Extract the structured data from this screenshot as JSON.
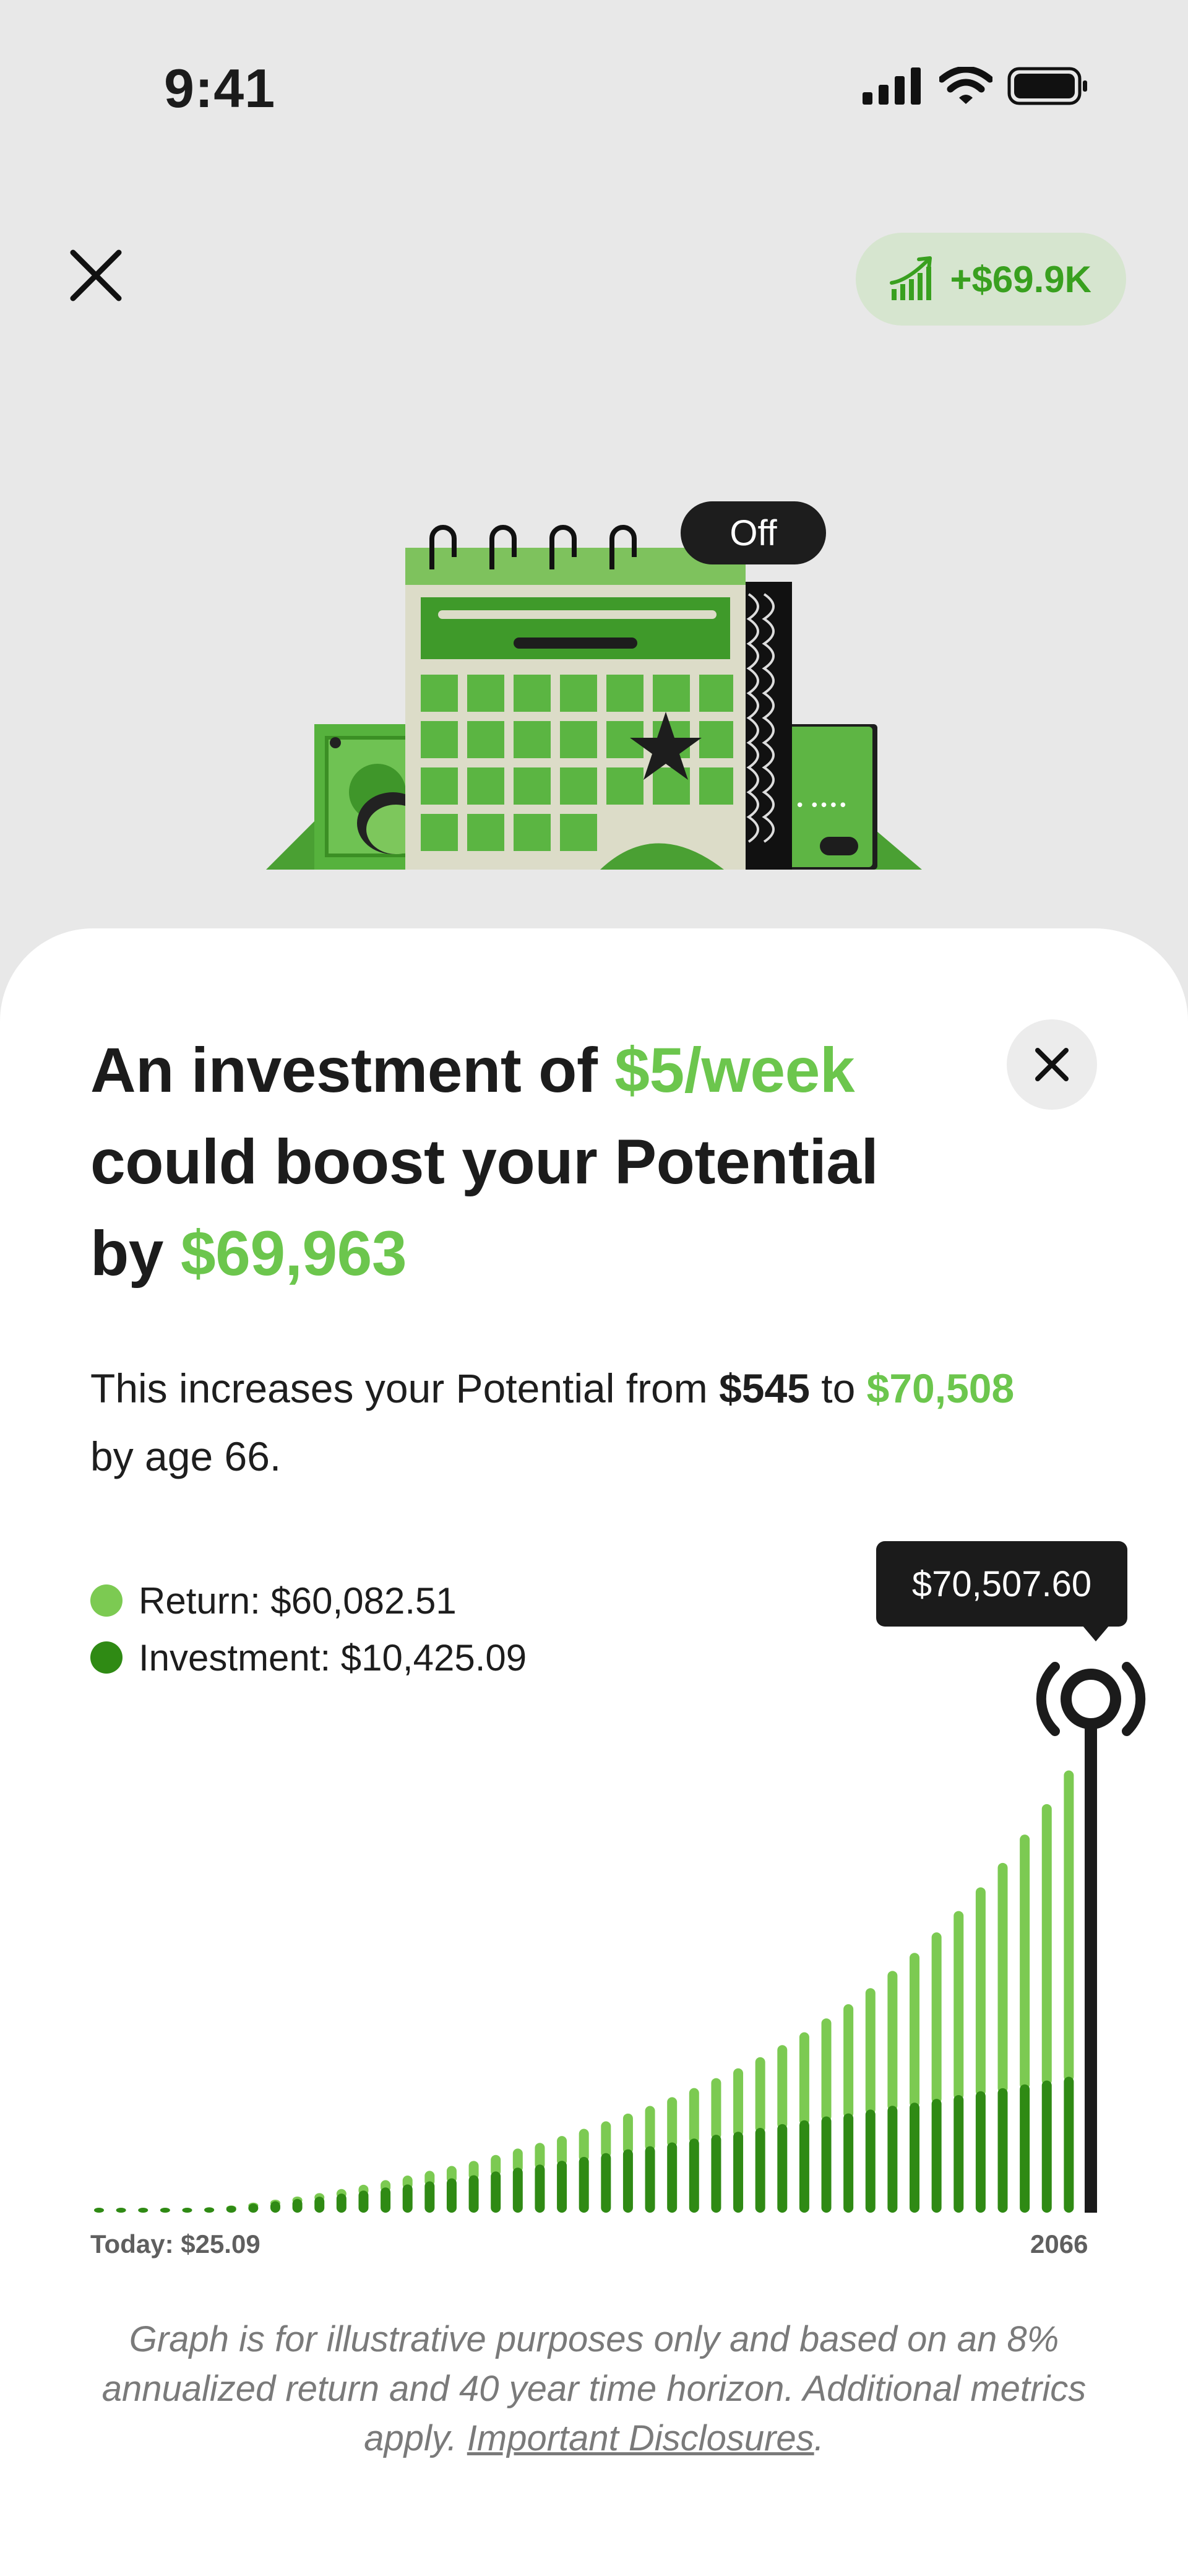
{
  "status_bar": {
    "time": "9:41"
  },
  "header": {
    "growth_pill": "+$69.9K"
  },
  "illustration": {
    "badge": "Off"
  },
  "sheet": {
    "headline_line1_prefix": "An investment of ",
    "headline_amount": "$5/week",
    "headline_line2": "could boost your Potential",
    "headline_line3_prefix": "by ",
    "headline_boost": "$69,963",
    "subtext_prefix": "This increases your Potential from ",
    "subtext_from": "$545",
    "subtext_mid": " to ",
    "subtext_to": "$70,508",
    "subtext_suffix": "by age 66.",
    "legend": {
      "return_label": "Return: $60,082.51",
      "investment_label": "Investment: $10,425.09"
    },
    "tooltip": "$70,507.60",
    "x_start_label": "Today: $25.09",
    "x_end_label": "2066",
    "footnote_text": "Graph is for illustrative purposes only and based on an 8% annualized return and 40 year time horizon. Additional metrics apply. ",
    "footnote_link": "Important Disclosures",
    "footnote_end": "."
  },
  "colors": {
    "return": "#7cca52",
    "investment": "#2f8a14",
    "accent": "#6cc64d",
    "dark": "#1b1b1b"
  },
  "chart_data": {
    "type": "bar",
    "stacked": true,
    "x_labels": [
      "Today: $25.09",
      "2066"
    ],
    "series": [
      {
        "name": "Return",
        "values": [
          0,
          0,
          0,
          0,
          0,
          5,
          20,
          60,
          100,
          160,
          230,
          300,
          380,
          480,
          580,
          690,
          810,
          940,
          1080,
          1250,
          1420,
          1620,
          1840,
          2080,
          2340,
          2640,
          2960,
          3310,
          3710,
          4150,
          4630,
          5170,
          5760,
          6420,
          7150,
          7950,
          8830,
          9810,
          10900,
          12050,
          13350,
          14750,
          16350,
          18100,
          20050,
          22050
        ]
      },
      {
        "name": "Investment",
        "values": [
          250,
          250,
          250,
          250,
          250,
          350,
          450,
          600,
          750,
          900,
          1050,
          1250,
          1450,
          1650,
          1850,
          2050,
          2250,
          2450,
          2700,
          2950,
          3150,
          3400,
          3650,
          3900,
          4150,
          4350,
          4600,
          4850,
          5100,
          5300,
          5550,
          5800,
          6050,
          6300,
          6500,
          6750,
          7000,
          7200,
          7450,
          7700,
          7950,
          8150,
          8400,
          8650,
          8900,
          9150
        ]
      }
    ],
    "legend": [
      "Return: $60,082.51",
      "Investment: $10,425.09"
    ],
    "highlight_total": "$70,507.60"
  }
}
